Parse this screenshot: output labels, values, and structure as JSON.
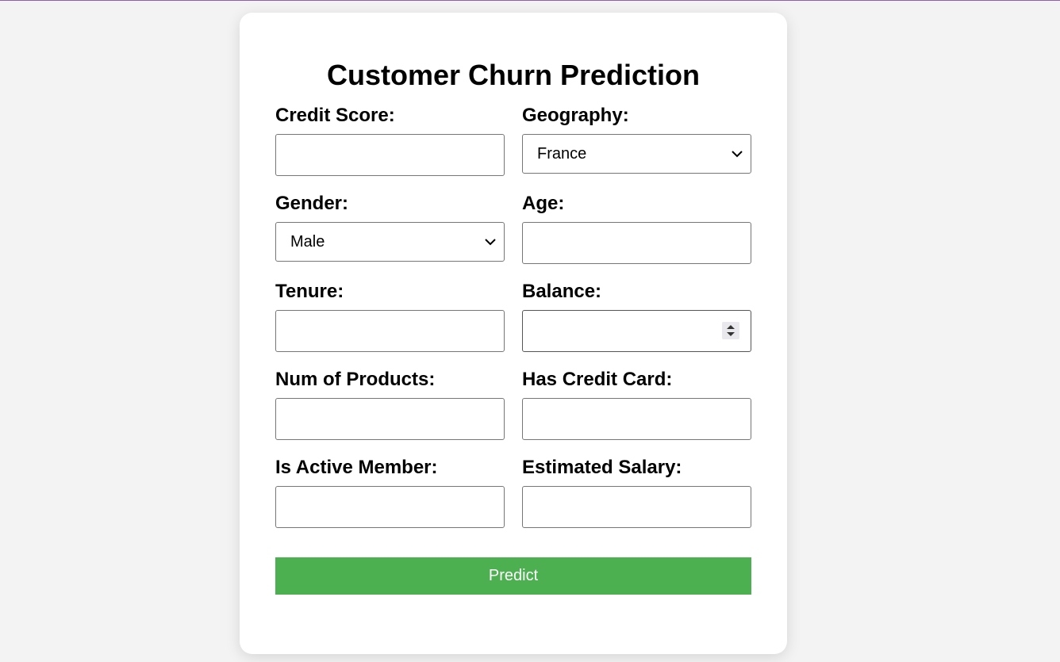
{
  "form": {
    "title": "Customer Churn Prediction",
    "fields": {
      "credit_score": {
        "label": "Credit Score:",
        "value": ""
      },
      "geography": {
        "label": "Geography:",
        "selected": "France"
      },
      "gender": {
        "label": "Gender:",
        "selected": "Male"
      },
      "age": {
        "label": "Age:",
        "value": ""
      },
      "tenure": {
        "label": "Tenure:",
        "value": ""
      },
      "balance": {
        "label": "Balance:",
        "value": ""
      },
      "num_products": {
        "label": "Num of Products:",
        "value": ""
      },
      "has_credit_card": {
        "label": "Has Credit Card:",
        "value": ""
      },
      "is_active_member": {
        "label": "Is Active Member:",
        "value": ""
      },
      "estimated_salary": {
        "label": "Estimated Salary:",
        "value": ""
      }
    },
    "submit_label": "Predict"
  },
  "colors": {
    "accent_button": "#4caf50",
    "background": "#f3f3f3",
    "card": "#ffffff",
    "top_border": "#8e5fb5"
  },
  "icons": {
    "select_arrow": "chevron-down-icon",
    "number_spinner": "spinner-icon"
  }
}
